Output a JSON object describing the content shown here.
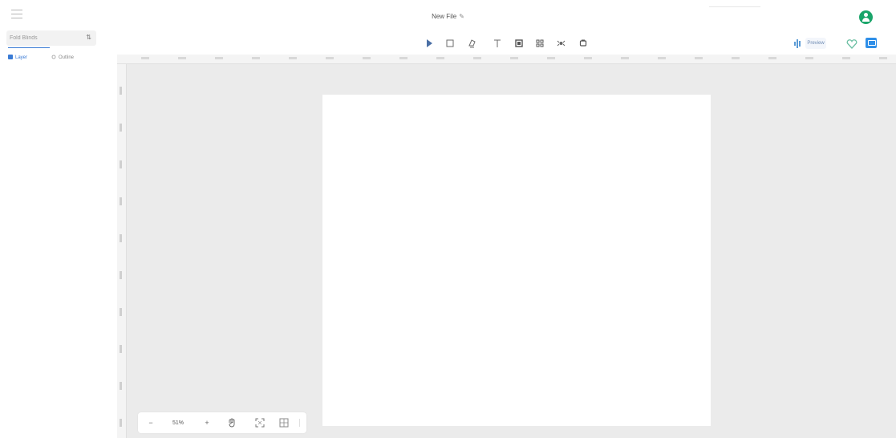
{
  "header": {
    "file_title": "New File",
    "edit_icon": "edit-pencil-icon",
    "menu_icon": "hamburger-menu-icon",
    "avatar_color": "#1aa56a"
  },
  "sidebar": {
    "search_placeholder": "Fold Blinds",
    "sort_icon": "sort-icon",
    "tabs": [
      {
        "label": "Layer",
        "icon": "layers-icon",
        "active": true
      },
      {
        "label": "Outline",
        "icon": "outline-icon",
        "active": false
      }
    ]
  },
  "toolbar": {
    "tools": [
      {
        "name": "select",
        "icon": "pointer-icon"
      },
      {
        "name": "rectangle",
        "icon": "rectangle-icon"
      },
      {
        "name": "pen",
        "icon": "pen-icon"
      },
      {
        "name": "text",
        "icon": "text-icon"
      },
      {
        "name": "frame",
        "icon": "frame-icon"
      },
      {
        "name": "component",
        "icon": "component-icon"
      },
      {
        "name": "hotspot",
        "icon": "hotspot-icon"
      },
      {
        "name": "layer",
        "icon": "layer-icon"
      }
    ],
    "right": {
      "present_label": "Preview",
      "accent": "#2f8fe8"
    }
  },
  "zoom": {
    "level": "51%",
    "minus": "−",
    "plus": "+"
  },
  "colors": {
    "canvas_bg": "#ebebeb",
    "artboard_bg": "#ffffff",
    "accent": "#3a7bd5"
  }
}
